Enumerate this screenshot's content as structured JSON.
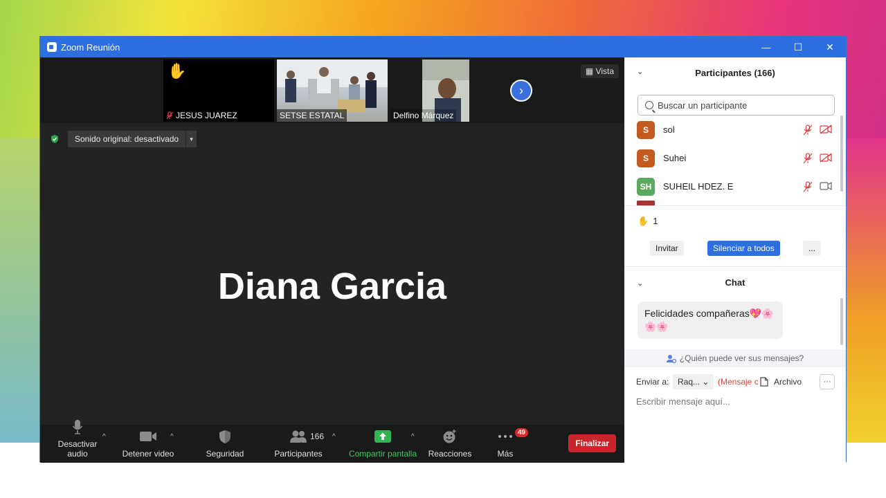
{
  "window": {
    "title": "Zoom Reunión",
    "minimize": "—",
    "maximize": "☐",
    "close": "✕"
  },
  "thumbnails": [
    {
      "name": "JESUS JUAREZ",
      "muted": true,
      "hand_raised": true
    },
    {
      "name": "SETSE ESTATAL",
      "muted": false,
      "hand_raised": false
    },
    {
      "name": "Delfino Márquez",
      "muted": false,
      "hand_raised": false
    }
  ],
  "vista_label": "Vista",
  "sound": {
    "label": "Sonido original: desactivado"
  },
  "active_speaker": "Diana Garcia",
  "toolbar": {
    "audio": "Desactivar audio",
    "video": "Detener video",
    "security": "Seguridad",
    "participants": "Participantes",
    "participants_count": "166",
    "share": "Compartir pantalla",
    "reactions": "Reacciones",
    "more": "Más",
    "more_badge": "49",
    "end": "Finalizar"
  },
  "participants_panel": {
    "title": "Participantes (166)",
    "search_placeholder": "Buscar un participante",
    "items": [
      {
        "initials": "S",
        "name": "sol",
        "color": "#c55a1e",
        "video_off": true
      },
      {
        "initials": "S",
        "name": "Suhei",
        "color": "#c55a1e",
        "video_off": true
      },
      {
        "initials": "SH",
        "name": "SUHEIL HDEZ. E",
        "color": "#5aa95f",
        "video_off": false
      }
    ],
    "raised_hands": "1",
    "invite": "Invitar",
    "mute_all": "Silenciar a todos",
    "more": "..."
  },
  "chat": {
    "title": "Chat",
    "message": "Felicidades compañeras💖🌸🌸🌸",
    "who_can_see": "¿Quién puede ver sus mensajes?",
    "send_to_label": "Enviar a:",
    "send_to_value": "Raq...",
    "private_label": "(Mensaje c",
    "file_label": "Archivo",
    "more": "···",
    "compose_placeholder": "Escribir mensaje aquí..."
  }
}
